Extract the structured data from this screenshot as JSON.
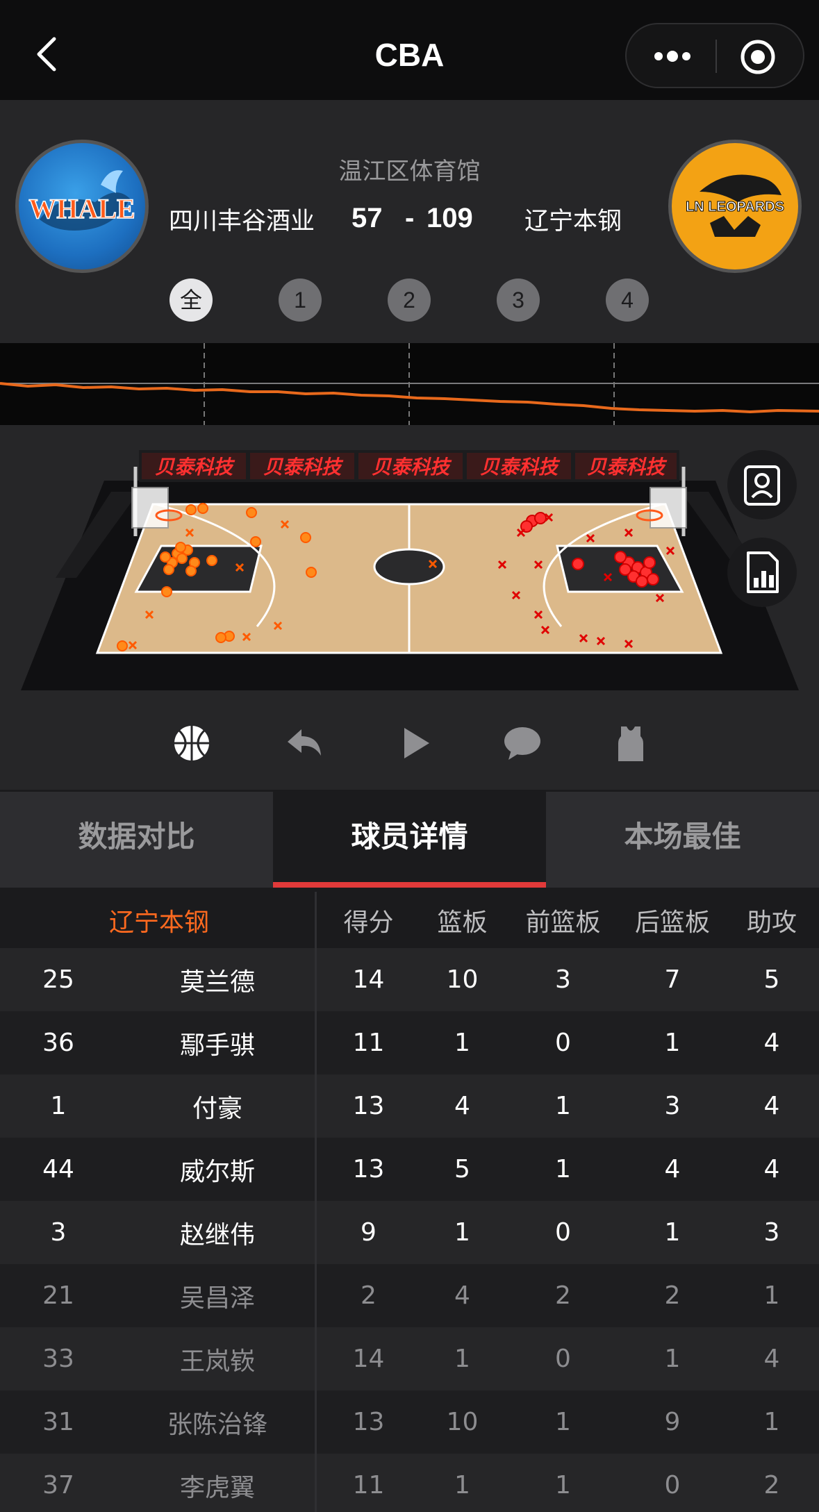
{
  "app": {
    "title": "CBA"
  },
  "game": {
    "venue": "温江区体育馆",
    "home_team": "四川丰谷酒业",
    "away_team": "辽宁本钢",
    "home_score": "57",
    "away_score": "109",
    "dash": "-",
    "home_logo_text": "WHALE",
    "away_logo_text": "LN LEOPARDS"
  },
  "quarters": [
    "全",
    "1",
    "2",
    "3",
    "4"
  ],
  "court": {
    "banner_text": [
      "贝泰科技",
      "贝泰科技",
      "贝泰科技",
      "贝泰科技",
      "贝泰科技"
    ]
  },
  "tabs": [
    {
      "label": "数据对比"
    },
    {
      "label": "球员详情"
    },
    {
      "label": "本场最佳"
    }
  ],
  "stats_table": {
    "team": "辽宁本钢",
    "columns": [
      "得分",
      "篮板",
      "前篮板",
      "后篮板",
      "助攻"
    ],
    "rows": [
      {
        "num": "25",
        "name": "莫兰德",
        "vals": [
          "14",
          "10",
          "3",
          "7",
          "5"
        ],
        "starter": true
      },
      {
        "num": "36",
        "name": "鄢手骐",
        "vals": [
          "11",
          "1",
          "0",
          "1",
          "4"
        ],
        "starter": true
      },
      {
        "num": "1",
        "name": "付豪",
        "vals": [
          "13",
          "4",
          "1",
          "3",
          "4"
        ],
        "starter": true
      },
      {
        "num": "44",
        "name": "威尔斯",
        "vals": [
          "13",
          "5",
          "1",
          "4",
          "4"
        ],
        "starter": true
      },
      {
        "num": "3",
        "name": "赵继伟",
        "vals": [
          "9",
          "1",
          "0",
          "1",
          "3"
        ],
        "starter": true
      },
      {
        "num": "21",
        "name": "吴昌泽",
        "vals": [
          "2",
          "4",
          "2",
          "2",
          "1"
        ],
        "starter": false
      },
      {
        "num": "33",
        "name": "王岚嵚",
        "vals": [
          "14",
          "1",
          "0",
          "1",
          "4"
        ],
        "starter": false
      },
      {
        "num": "31",
        "name": "张陈治锋",
        "vals": [
          "13",
          "10",
          "1",
          "9",
          "1"
        ],
        "starter": false
      },
      {
        "num": "37",
        "name": "李虎翼",
        "vals": [
          "11",
          "1",
          "1",
          "0",
          "2"
        ],
        "starter": false
      }
    ]
  }
}
